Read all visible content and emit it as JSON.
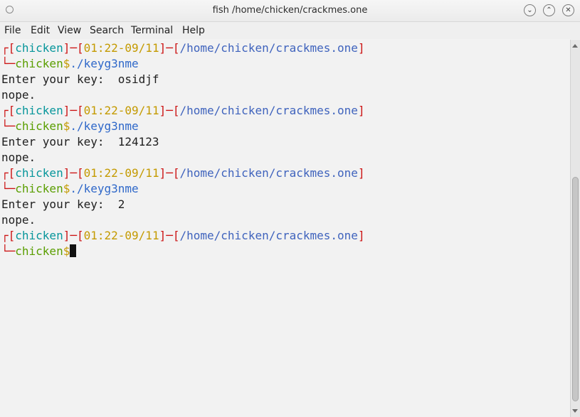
{
  "window": {
    "title": "fish /home/chicken/crackmes.one",
    "minimize_glyph": "⌄",
    "maximize_glyph": "⌃",
    "close_glyph": "✕"
  },
  "menu": {
    "items": [
      "File",
      "Edit",
      "View",
      "Search",
      "Terminal",
      "Help"
    ]
  },
  "terminal": {
    "prompt": {
      "user": "chicken",
      "time": "01:22-09/11",
      "cwd": "/home/chicken/crackmes.one",
      "symbol": "$"
    },
    "sessions": [
      {
        "command": "./keyg3nme",
        "input_line": "Enter your key:  osidjf",
        "output": "nope."
      },
      {
        "command": "./keyg3nme",
        "input_line": "Enter your key:  124123",
        "output": "nope."
      },
      {
        "command": "./keyg3nme",
        "input_line": "Enter your key:  2",
        "output": "nope."
      }
    ]
  },
  "colors": {
    "bracket": "#cc1414",
    "user": "#07969b",
    "time": "#c49a00",
    "path": "#3f63bd",
    "prompt_user": "#5a9e00",
    "command": "#2f68c9"
  }
}
